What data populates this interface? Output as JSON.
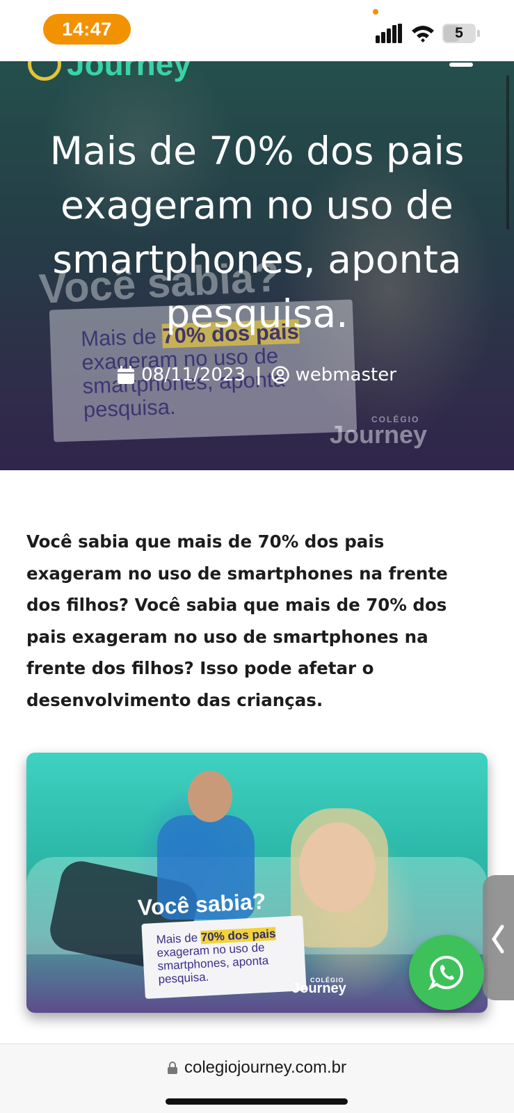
{
  "status_bar": {
    "time": "14:47",
    "battery": "5",
    "colors": {
      "time_pill": "#f39200"
    }
  },
  "header": {
    "logo_text": "Journey",
    "menu_icon": "hamburger-icon"
  },
  "hero": {
    "title": "Mais de 70% dos pais exageram no uso de smartphones, aponta pesquisa.",
    "date": "08/11/2023",
    "separator": "|",
    "author": "webmaster",
    "bg_headline": "Você sabia?",
    "bg_card_prefix": "Mais de ",
    "bg_card_highlight": "70% dos pais",
    "bg_card_rest": " exageram no uso de smartphones, aponta pesquisa.",
    "bg_brand_small": "COLÉGIO",
    "bg_brand": "Journey"
  },
  "article": {
    "intro": "Você sabia que mais de 70% dos pais exageram no uso de smartphones na frente dos filhos? Você sabia que mais de 70% dos pais exageram no uso de smartphones na frente dos filhos? Isso pode afetar o desenvolvimento das crianças.",
    "image": {
      "headline": "Você sabia?",
      "card_prefix": "Mais de ",
      "card_highlight": "70% dos pais",
      "card_rest": " exageram no uso de smartphones, aponta pesquisa.",
      "brand_small": "COLÉGIO",
      "brand": "Journey"
    }
  },
  "floating": {
    "side_tab_icon": "chevron-left-icon",
    "whatsapp_icon": "whatsapp-icon",
    "whatsapp_color": "#3ec15a"
  },
  "browser": {
    "url": "colegiojourney.com.br",
    "lock_icon": "lock-icon"
  }
}
